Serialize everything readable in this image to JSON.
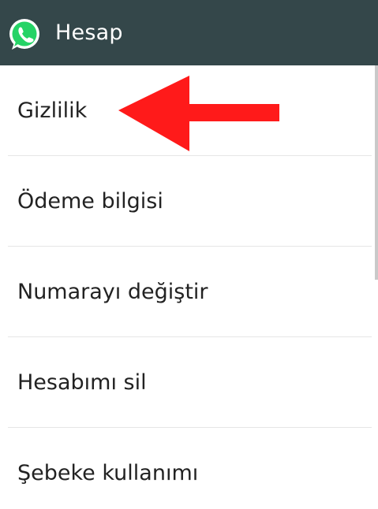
{
  "action_bar": {
    "title": "Hesap",
    "icon": "whatsapp-icon",
    "background_color": "#34474a"
  },
  "menu": {
    "items": [
      {
        "label": "Gizlilik"
      },
      {
        "label": "Ödeme bilgisi"
      },
      {
        "label": "Numarayı değiştir"
      },
      {
        "label": "Hesabımı sil"
      },
      {
        "label": "Şebeke kullanımı"
      }
    ]
  },
  "annotation": {
    "icon": "red-arrow-left-icon",
    "color": "#ff1a1a"
  }
}
